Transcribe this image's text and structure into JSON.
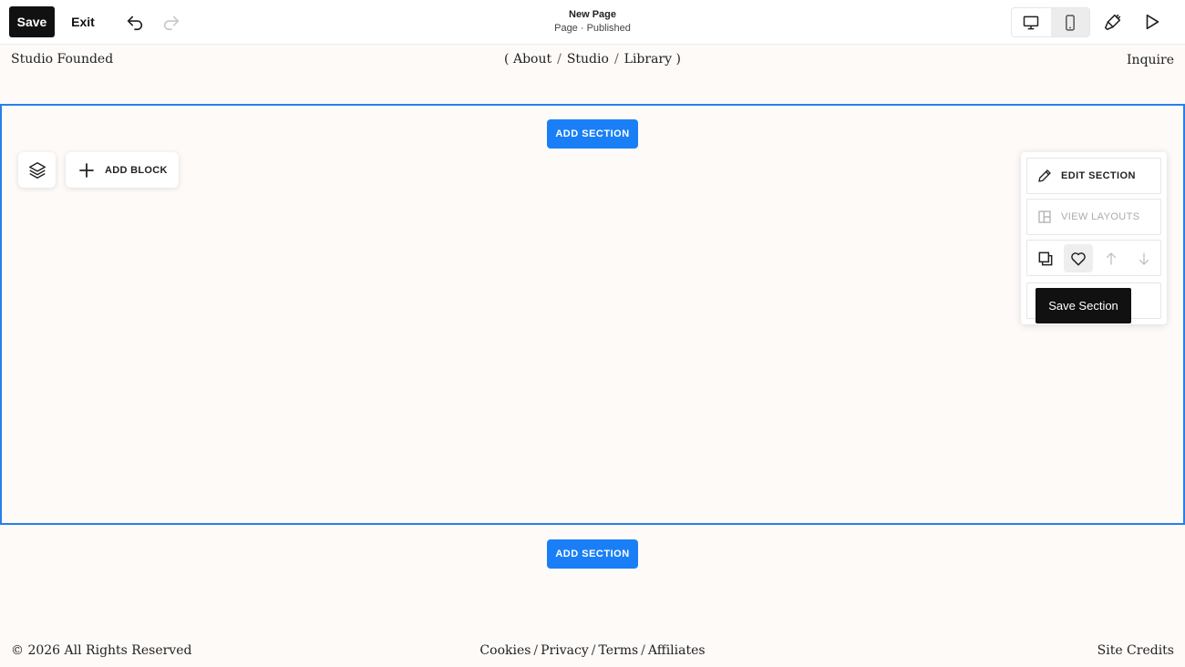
{
  "toolbar": {
    "save_label": "Save",
    "exit_label": "Exit",
    "page_title": "New Page",
    "page_status": "Page · Published",
    "icons": [
      "undo-icon",
      "redo-icon",
      "desktop-icon",
      "mobile-icon",
      "paintbrush-icon",
      "play-icon"
    ]
  },
  "site_header": {
    "title": "Studio Founded",
    "nav_open": "(",
    "nav": [
      "About",
      "Studio",
      "Library"
    ],
    "nav_close": ")",
    "nav_separator": "/",
    "cta": "Inquire"
  },
  "section": {
    "add_section_label": "ADD SECTION",
    "add_block_label": "ADD BLOCK",
    "accent_color": "#1a7ff6"
  },
  "section_panel": {
    "edit_label": "EDIT SECTION",
    "layouts_label": "VIEW LAYOUTS",
    "tooltip": "Save Section"
  },
  "footer": {
    "copyright": "© 2026 All Rights Reserved",
    "links": [
      "Cookies",
      "Privacy",
      "Terms",
      "Affiliates"
    ],
    "link_separator": "/",
    "credits": "Site Credits"
  }
}
